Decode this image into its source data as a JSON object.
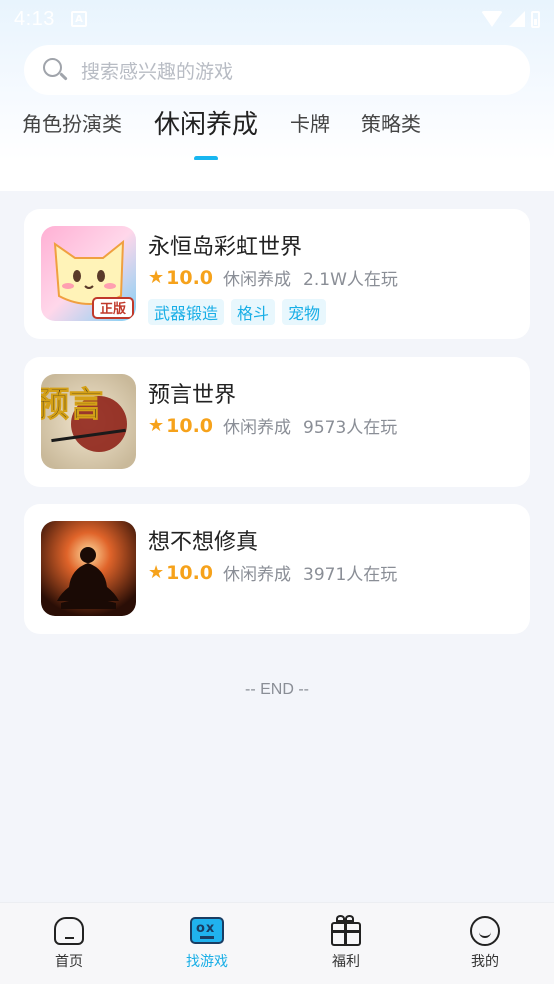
{
  "status_bar": {
    "time": "4:13"
  },
  "search": {
    "placeholder": "搜索感兴趣的游戏"
  },
  "tabs": [
    {
      "label": "角色扮演类",
      "active": false
    },
    {
      "label": "休闲养成",
      "active": true
    },
    {
      "label": "卡牌",
      "active": false
    },
    {
      "label": "策略类",
      "active": false
    }
  ],
  "games": [
    {
      "title": "永恒岛彩虹世界",
      "rating": "10.0",
      "genre": "休闲养成",
      "players": "2.1W人在玩",
      "tags": [
        "武器锻造",
        "格斗",
        "宠物"
      ],
      "icon": "cute-cat-game-icon",
      "icon_badge": "正版"
    },
    {
      "title": "预言世界",
      "rating": "10.0",
      "genre": "休闲养成",
      "players": "9573人在玩",
      "tags": [],
      "icon": "prophecy-calligraphy-icon",
      "icon_text": "预言"
    },
    {
      "title": "想不想修真",
      "rating": "10.0",
      "genre": "休闲养成",
      "players": "3971人在玩",
      "tags": [],
      "icon": "meditating-cultivator-icon"
    }
  ],
  "list_end": "-- END --",
  "bottom_nav": [
    {
      "label": "首页",
      "icon": "home-icon",
      "active": false
    },
    {
      "label": "找游戏",
      "icon": "gamepad-icon",
      "active": true
    },
    {
      "label": "福利",
      "icon": "gift-icon",
      "active": false
    },
    {
      "label": "我的",
      "icon": "smiley-icon",
      "active": false
    }
  ],
  "colors": {
    "accent": "#18b6f0",
    "rating": "#f6a21b",
    "tag_bg": "#e8f7fd",
    "page_bg": "#f3f5fa"
  }
}
